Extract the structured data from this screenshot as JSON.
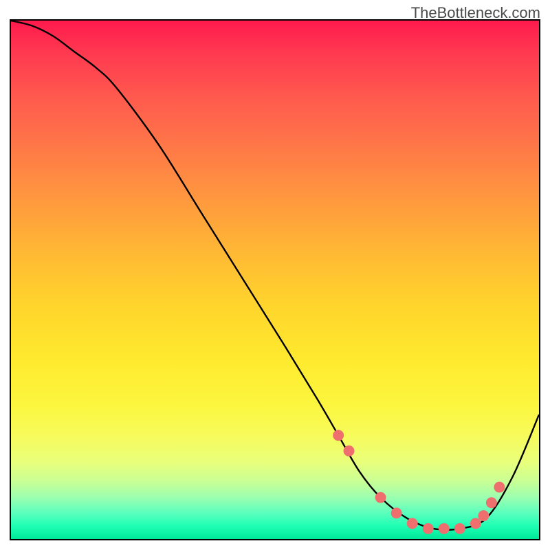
{
  "watermark": "TheBottleneck.com",
  "chart_data": {
    "type": "line",
    "title": "",
    "xlabel": "",
    "ylabel": "",
    "xlim": [
      0,
      100
    ],
    "ylim": [
      0,
      100
    ],
    "series": [
      {
        "name": "curve",
        "x": [
          0,
          4,
          8,
          12,
          16,
          20,
          28,
          36,
          44,
          52,
          58,
          62,
          66,
          70,
          75,
          80,
          85,
          90,
          95,
          100
        ],
        "y": [
          100,
          99,
          97,
          94,
          91,
          87,
          76,
          63,
          50,
          37,
          27,
          20,
          13,
          8,
          4,
          2,
          2,
          4,
          12,
          24
        ]
      }
    ],
    "markers": {
      "name": "highlight-dots",
      "x": [
        62,
        64,
        70,
        73,
        76,
        79,
        82,
        85,
        88,
        89.5,
        91,
        92.5
      ],
      "y": [
        20,
        17,
        8,
        5,
        3,
        2,
        2,
        2,
        3,
        4.5,
        7,
        10
      ]
    },
    "gradient_stops": [
      {
        "pos": 0,
        "color": "#ff1a4d"
      },
      {
        "pos": 25,
        "color": "#ff7a47"
      },
      {
        "pos": 50,
        "color": "#ffc530"
      },
      {
        "pos": 75,
        "color": "#f7fb5b"
      },
      {
        "pos": 90,
        "color": "#b3ffa2"
      },
      {
        "pos": 100,
        "color": "#00e89a"
      }
    ]
  }
}
